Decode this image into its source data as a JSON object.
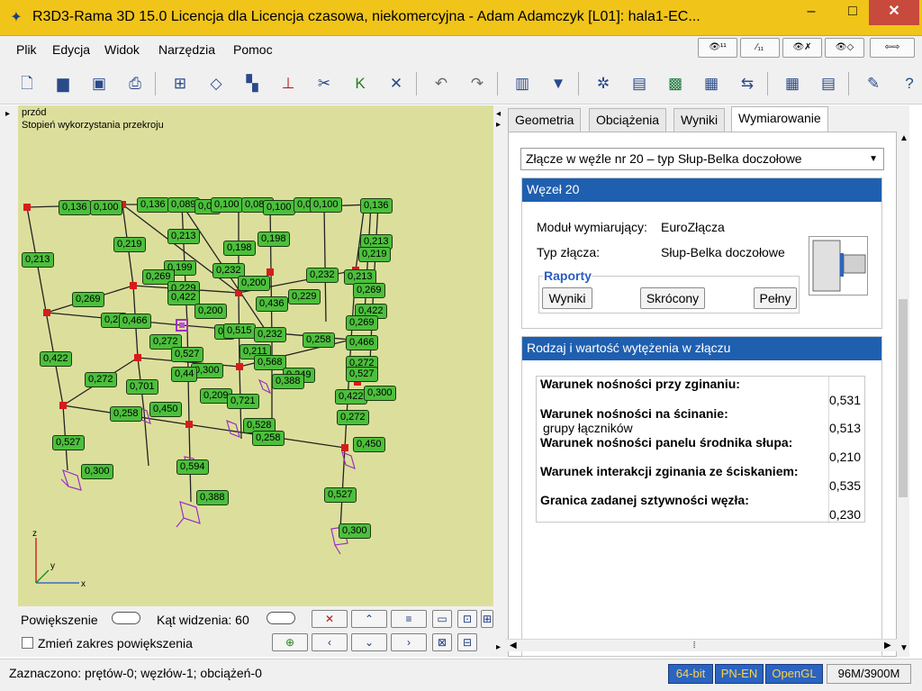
{
  "window": {
    "title": "R3D3-Rama 3D 15.0 Licencja dla Licencja czasowa, niekomercyjna - Adam Adamczyk [L01]: hala1-EC...",
    "minimize": "–",
    "maximize": "□",
    "close": "✕"
  },
  "menu": {
    "items": [
      "Plik",
      "Edycja",
      "Widok",
      "Narzędzia",
      "Pomoc"
    ],
    "view_buttons": [
      "👁¹¹",
      "⁄₁₁",
      "👁✗",
      "👁◇",
      "⇦⇨"
    ]
  },
  "toolbar": {
    "icons": [
      "new-file-icon",
      "open-folder-icon",
      "save-icon",
      "print-preview-icon",
      "frame-icon",
      "add-node-icon",
      "move-icon",
      "support-icon",
      "cut-icon",
      "add-bar-icon",
      "delete-icon",
      "undo-icon",
      "redo-icon",
      "grid-icon",
      "filter-icon",
      "settings-icon",
      "table-icon",
      "3d-view-icon",
      "pattern-icon",
      "sort-icon",
      "calculator-icon",
      "report-icon",
      "tools-icon",
      "help-icon"
    ]
  },
  "viewport": {
    "line1": "przód",
    "line2": "Stopień wykorzystania przekroju",
    "labels": [
      "0,136",
      "0,100",
      "0,136",
      "0,089",
      "0,08",
      "0,100",
      "0,080",
      "0,100",
      "0,0",
      "0,100",
      "0,136",
      "0,213",
      "0,219",
      "0,213",
      "0,198",
      "0,198",
      "0,213",
      "0,219",
      "0,199",
      "0,232",
      "0,269",
      "0,232",
      "0,213",
      "0,229",
      "0,200",
      "0,269",
      "0,269",
      "0,422",
      "0,436",
      "0,229",
      "0,422",
      "0,200",
      "0,23",
      "0,466",
      "0,0",
      "0,515",
      "0,269",
      "0,272",
      "0,232",
      "0,258",
      "0,466",
      "0,211",
      "0,422",
      "0,527",
      "0,568",
      "0,272",
      "0,300",
      "0,44",
      "0,249",
      "0,527",
      "0,272",
      "0,388",
      "0,701",
      "0,209",
      "0,422",
      "0,300",
      "0,450",
      "0,721",
      "0,258",
      "0,272",
      "0,528",
      "0,258",
      "0,450",
      "0,527",
      "0,594",
      "0,300",
      "0,388",
      "0,527",
      "0,300"
    ]
  },
  "controls": {
    "zoom_label": "Powiększenie",
    "fov_label": "Kąt widzenia: 60",
    "zoom_range_label": "Zmień zakres powiększenia",
    "buttons": [
      "✕",
      "⌃",
      "≡",
      "▭",
      "⊡",
      "⊞",
      "⊕",
      "‹",
      "⌄",
      "›",
      "⊠",
      "⊟"
    ]
  },
  "panel": {
    "tabs": [
      "Geometria",
      "Obciążenia",
      "Wyniki",
      "Wymiarowanie"
    ],
    "selector": "Złącze w węźle nr 20 – typ Słup-Belka doczołowe",
    "node_header": "Węzeł 20",
    "module_label": "Moduł wymiarujący:",
    "module_value": "EuroZłącza",
    "type_label": "Typ złącza:",
    "type_value": "Słup-Belka doczołowe",
    "reports_caption": "Raporty",
    "report_buttons": [
      "Wyniki",
      "Skrócony",
      "Pełny"
    ],
    "results_header": "Rodzaj i wartość wytężenia w złączu",
    "criteria": [
      {
        "label": "Warunek nośności przy zginaniu:",
        "sub": "",
        "value": "0,531"
      },
      {
        "label": "Warunek nośności na ścinanie:",
        "sub": "grupy łączników",
        "value": "0,513"
      },
      {
        "label": "Warunek nośności panelu środnika słupa:",
        "sub": "",
        "value": "0,210"
      },
      {
        "label": "Warunek interakcji zginania ze ściskaniem:",
        "sub": "",
        "value": "0,535"
      },
      {
        "label": "Granica zadanej sztywności węzła:",
        "sub": "",
        "value": "0,230"
      }
    ]
  },
  "status": {
    "selection": "Zaznaczono: prętów-0; węzłów-1; obciążeń-0",
    "bits": "64-bit",
    "norm": "PN-EN",
    "renderer": "OpenGL",
    "memory": "96M/3900M"
  },
  "colors": {
    "title_bar": "#f0c419",
    "viewport_bg": "#dcdf9c",
    "label_bg": "#4cbf3c",
    "node": "#d81b1b",
    "section_header": "#1f5fb0",
    "support": "#9b30c0"
  }
}
